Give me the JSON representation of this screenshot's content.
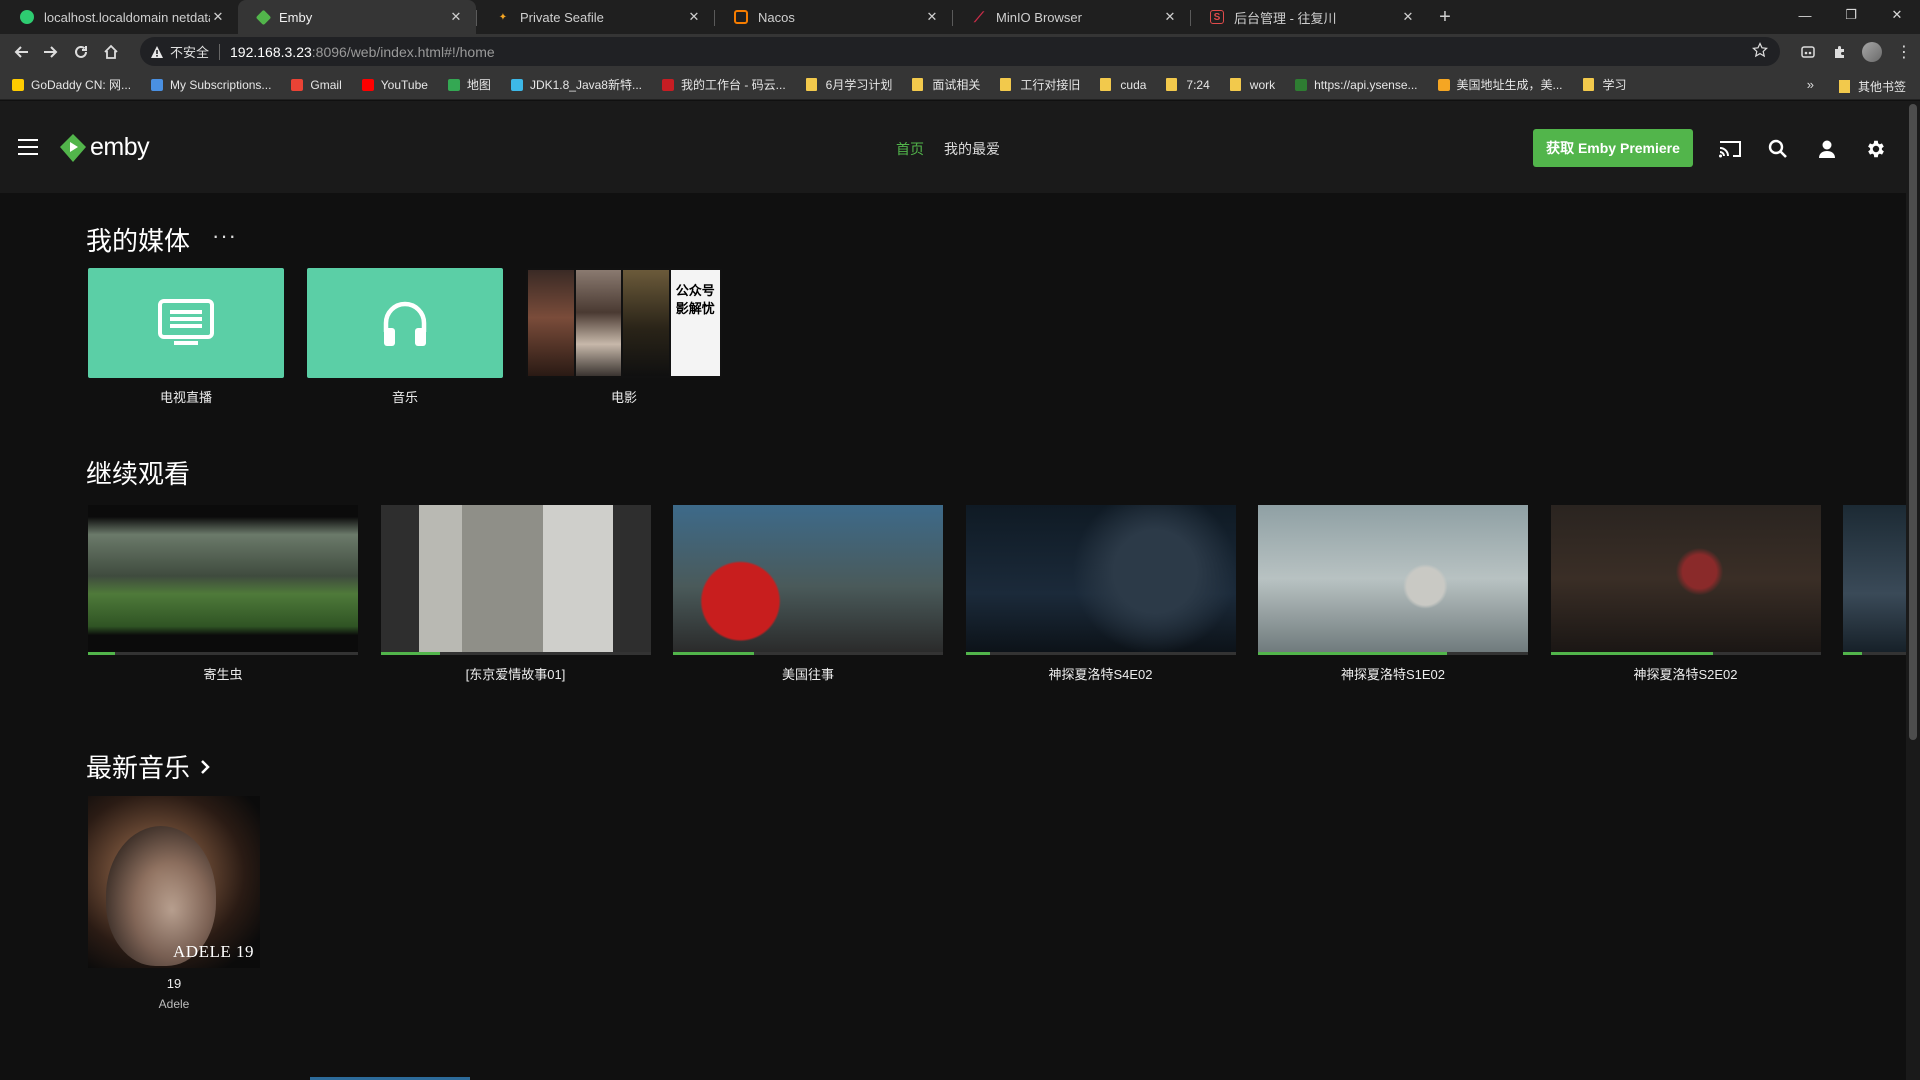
{
  "browser": {
    "tabs": [
      {
        "title": "localhost.localdomain netdata",
        "fav_color": "#2ecc71"
      },
      {
        "title": "Emby",
        "fav_color": "#52b54b",
        "active": true
      },
      {
        "title": "Private Seafile",
        "fav_color": "#f5a623"
      },
      {
        "title": "Nacos",
        "fav_color": "#f57c00"
      },
      {
        "title": "MinIO Browser",
        "fav_color": "#c72c48"
      },
      {
        "title": "后台管理 - 往复川",
        "fav_color": "#e04b4b"
      }
    ],
    "address": {
      "security": "不安全",
      "host": "192.168.3.23",
      "path": ":8096/web/index.html#!/home"
    },
    "bookmarks": [
      {
        "label": "GoDaddy CN: 网...",
        "icon": "godaddy-icon",
        "color": "#ffcc00"
      },
      {
        "label": "My Subscriptions...",
        "icon": "v-icon",
        "color": "#4a90e2"
      },
      {
        "label": "Gmail",
        "icon": "gmail-icon",
        "color": "#ea4335"
      },
      {
        "label": "YouTube",
        "icon": "youtube-icon",
        "color": "#ff0000"
      },
      {
        "label": "地图",
        "icon": "maps-icon",
        "color": "#34a853"
      },
      {
        "label": "JDK1.8_Java8新特...",
        "icon": "bilibili-icon",
        "color": "#3db8e8"
      },
      {
        "label": "我的工作台 - 码云...",
        "icon": "gitee-icon",
        "color": "#c71d23"
      },
      {
        "label": "6月学习计划",
        "icon": "folder-icon"
      },
      {
        "label": "面试相关",
        "icon": "folder-icon"
      },
      {
        "label": "工行对接旧",
        "icon": "folder-icon"
      },
      {
        "label": "cuda",
        "icon": "folder-icon"
      },
      {
        "label": "7:24",
        "icon": "folder-icon"
      },
      {
        "label": "work",
        "icon": "folder-icon"
      },
      {
        "label": "https://api.ysense...",
        "icon": "ysense-icon",
        "color": "#2e7d32"
      },
      {
        "label": "美国地址生成，美...",
        "icon": "site-icon",
        "color": "#f5a623"
      },
      {
        "label": "学习",
        "icon": "folder-icon"
      }
    ],
    "bookmarks_more": "»",
    "other_bookmarks": "其他书签"
  },
  "emby": {
    "logo_text": "emby",
    "nav": [
      "首页",
      "我的最爱"
    ],
    "premiere_button": "获取 Emby Premiere",
    "sections": {
      "my_media": "我的媒体",
      "more": "···",
      "continue_watching": "继续观看",
      "latest_music": "最新音乐"
    },
    "libraries": [
      {
        "label": "电视直播",
        "icon": "tv-icon"
      },
      {
        "label": "音乐",
        "icon": "headphones-icon"
      },
      {
        "label": "电影",
        "icon": "movie-collage",
        "collage_text": "公众号\n影解忧"
      }
    ],
    "continue_watching": [
      {
        "title": "寄生虫",
        "progress": 0.1
      },
      {
        "title": "[东京爱情故事01]",
        "progress": 0.22
      },
      {
        "title": "美国往事",
        "progress": 0.3
      },
      {
        "title": "神探夏洛特S4E02",
        "progress": 0.09
      },
      {
        "title": "神探夏洛特S1E02",
        "progress": 0.7
      },
      {
        "title": "神探夏洛特S2E02",
        "progress": 0.6
      },
      {
        "title": "",
        "progress": 0.3
      }
    ],
    "latest_music": [
      {
        "album": "19",
        "artist": "Adele",
        "cover_text": "ADELE 19"
      }
    ],
    "colors": {
      "accent": "#52b54b",
      "library_tile": "#5bcfa6"
    }
  }
}
